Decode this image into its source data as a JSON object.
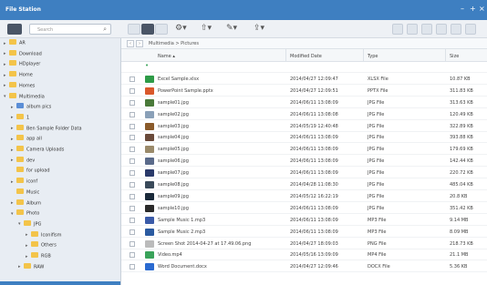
{
  "app": {
    "title": "File Station"
  },
  "window_controls": {
    "minimize": "–",
    "maximize": "+",
    "close": "×"
  },
  "toolbar": {
    "search_placeholder": "Search"
  },
  "breadcrumb": {
    "path": "Multimedia > Pictures"
  },
  "sidebar": {
    "items": [
      {
        "label": "AR",
        "depth": 0,
        "caret": "▸",
        "color": "#f3c44a"
      },
      {
        "label": "Download",
        "depth": 0,
        "caret": "▸",
        "color": "#f3c44a"
      },
      {
        "label": "HDplayer",
        "depth": 0,
        "caret": "▸",
        "color": "#f3c44a"
      },
      {
        "label": "Home",
        "depth": 0,
        "caret": "▸",
        "color": "#f3c44a"
      },
      {
        "label": "Homes",
        "depth": 0,
        "caret": "▸",
        "color": "#f3c44a"
      },
      {
        "label": "Multimedia",
        "depth": 0,
        "caret": "▾",
        "color": "#f3c44a"
      },
      {
        "label": "album pics",
        "depth": 1,
        "caret": "▸",
        "color": "#5b8ed6"
      },
      {
        "label": "1",
        "depth": 1,
        "caret": "▸",
        "color": "#f3c44a"
      },
      {
        "label": "Ben Sample Folder Data",
        "depth": 1,
        "caret": "▸",
        "color": "#f3c44a"
      },
      {
        "label": "app all",
        "depth": 1,
        "caret": "▸",
        "color": "#f3c44a"
      },
      {
        "label": "Camera Uploads",
        "depth": 1,
        "caret": "▸",
        "color": "#f3c44a"
      },
      {
        "label": "dev",
        "depth": 1,
        "caret": "▸",
        "color": "#f3c44a"
      },
      {
        "label": "for upload",
        "depth": 1,
        "caret": "",
        "color": "#f3c44a"
      },
      {
        "label": "iconf",
        "depth": 1,
        "caret": "▸",
        "color": "#f3c44a"
      },
      {
        "label": "Music",
        "depth": 1,
        "caret": "",
        "color": "#f3c44a"
      },
      {
        "label": "Album",
        "depth": 1,
        "caret": "▸",
        "color": "#f3c44a"
      },
      {
        "label": "Photo",
        "depth": 1,
        "caret": "▾",
        "color": "#f3c44a"
      },
      {
        "label": "JPG",
        "depth": 2,
        "caret": "▾",
        "color": "#f3c44a"
      },
      {
        "label": "Iconifism",
        "depth": 3,
        "caret": "▸",
        "color": "#f3c44a"
      },
      {
        "label": "Others",
        "depth": 3,
        "caret": "▸",
        "color": "#f3c44a"
      },
      {
        "label": "RGB",
        "depth": 3,
        "caret": "▸",
        "color": "#f3c44a"
      },
      {
        "label": "RAW",
        "depth": 2,
        "caret": "▸",
        "color": "#f3c44a"
      }
    ]
  },
  "grid": {
    "columns": {
      "name": "Name ▴",
      "modified": "Modified Date",
      "type": "Type",
      "size": "Size"
    },
    "rows": [
      {
        "name": "",
        "date": "",
        "type": "",
        "size": "",
        "thumb": "up"
      },
      {
        "name": "Excel Sample.xlsx",
        "date": "2014/04/27 12:09:47",
        "type": "XLSX File",
        "size": "10.87 KB",
        "thumb": "#2e9b47"
      },
      {
        "name": "PowerPoint Sample.pptx",
        "date": "2014/04/27 12:09:51",
        "type": "PPTX File",
        "size": "311.83 KB",
        "thumb": "#d9582b"
      },
      {
        "name": "sample01.jpg",
        "date": "2014/06/11 13:08:09",
        "type": "JPG File",
        "size": "313.63 KB",
        "thumb": "#4a7a3a"
      },
      {
        "name": "sample02.jpg",
        "date": "2014/06/11 13:08:08",
        "type": "JPG File",
        "size": "120.49 KB",
        "thumb": "#8aa0b8"
      },
      {
        "name": "sample03.jpg",
        "date": "2014/05/19 12:40:48",
        "type": "JPG File",
        "size": "322.89 KB",
        "thumb": "#8a5a2a"
      },
      {
        "name": "sample04.jpg",
        "date": "2014/06/11 13:08:09",
        "type": "JPG File",
        "size": "393.88 KB",
        "thumb": "#6a4a3a"
      },
      {
        "name": "sample05.jpg",
        "date": "2014/06/11 13:08:09",
        "type": "JPG File",
        "size": "179.69 KB",
        "thumb": "#9a8a6a"
      },
      {
        "name": "sample06.jpg",
        "date": "2014/06/11 13:08:09",
        "type": "JPG File",
        "size": "142.44 KB",
        "thumb": "#5a6a8a"
      },
      {
        "name": "sample07.jpg",
        "date": "2014/06/11 13:08:09",
        "type": "JPG File",
        "size": "220.72 KB",
        "thumb": "#2a3a6a"
      },
      {
        "name": "sample08.jpg",
        "date": "2014/04/28 11:08:30",
        "type": "JPG File",
        "size": "485.04 KB",
        "thumb": "#3a4a5a"
      },
      {
        "name": "sample09.jpg",
        "date": "2014/05/12 16:22:19",
        "type": "JPG File",
        "size": "20.8 KB",
        "thumb": "#1a2a3a"
      },
      {
        "name": "sample10.jpg",
        "date": "2014/06/11 13:08:09",
        "type": "JPG File",
        "size": "351.42 KB",
        "thumb": "#2a2a2a"
      },
      {
        "name": "Sample Music 1.mp3",
        "date": "2014/06/11 13:08:09",
        "type": "MP3 File",
        "size": "9.14 MB",
        "thumb": "#3a5aa8"
      },
      {
        "name": "Sample Music 2.mp3",
        "date": "2014/06/11 13:08:09",
        "type": "MP3 File",
        "size": "8.09 MB",
        "thumb": "#2a5aa0"
      },
      {
        "name": "Screen Shot 2014-04-27 at 17.49.06.png",
        "date": "2014/04/27 18:09:03",
        "type": "PNG File",
        "size": "218.73 KB",
        "thumb": "#bbbbbb"
      },
      {
        "name": "Video.mp4",
        "date": "2014/05/16 13:09:09",
        "type": "MP4 File",
        "size": "21.1 MB",
        "thumb": "#3aa35a"
      },
      {
        "name": "Word Document.docx",
        "date": "2014/04/27 12:09:46",
        "type": "DOCX File",
        "size": "5.36 KB",
        "thumb": "#2a6ad0"
      }
    ]
  }
}
